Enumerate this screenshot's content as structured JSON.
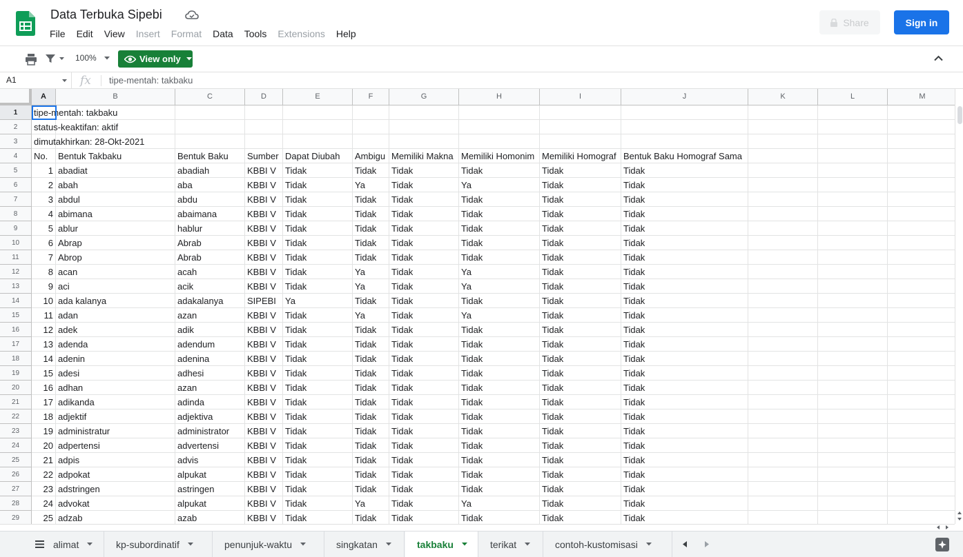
{
  "document": {
    "title": "Data Terbuka Sipebi"
  },
  "menu": [
    {
      "label": "File",
      "enabled": true
    },
    {
      "label": "Edit",
      "enabled": true
    },
    {
      "label": "View",
      "enabled": true
    },
    {
      "label": "Insert",
      "enabled": false
    },
    {
      "label": "Format",
      "enabled": false
    },
    {
      "label": "Data",
      "enabled": true
    },
    {
      "label": "Tools",
      "enabled": true
    },
    {
      "label": "Extensions",
      "enabled": false
    },
    {
      "label": "Help",
      "enabled": true
    }
  ],
  "header": {
    "share_label": "Share",
    "signin_label": "Sign in"
  },
  "toolbar": {
    "zoom": "100%",
    "view_only_label": "View only"
  },
  "formula_bar": {
    "cell_ref": "A1",
    "content": "tipe-mentah: takbaku"
  },
  "columns": [
    "A",
    "B",
    "C",
    "D",
    "E",
    "F",
    "G",
    "H",
    "I",
    "J",
    "K",
    "L",
    "M"
  ],
  "selected_column": "A",
  "rows": [
    {
      "n": "1",
      "cells": [
        "tipe-mentah: takbaku",
        "",
        "",
        "",
        "",
        "",
        "",
        "",
        "",
        ""
      ]
    },
    {
      "n": "2",
      "cells": [
        "status-keaktifan: aktif",
        "",
        "",
        "",
        "",
        "",
        "",
        "",
        "",
        ""
      ]
    },
    {
      "n": "3",
      "cells": [
        "dimutakhirkan: 28-Okt-2021",
        "",
        "",
        "",
        "",
        "",
        "",
        "",
        "",
        ""
      ]
    },
    {
      "n": "4",
      "cells": [
        "No.",
        "Bentuk Takbaku",
        "Bentuk Baku",
        "Sumber",
        "Dapat Diubah",
        "Ambigu",
        "Memiliki Makna",
        "Memiliki Homonim",
        "Memiliki Homograf",
        "Bentuk Baku Homograf Sama"
      ]
    },
    {
      "n": "5",
      "cells": [
        "1",
        "abadiat",
        "abadiah",
        "KBBI V",
        "Tidak",
        "Tidak",
        "Tidak",
        "Tidak",
        "Tidak",
        "Tidak"
      ]
    },
    {
      "n": "6",
      "cells": [
        "2",
        "abah",
        "aba",
        "KBBI V",
        "Tidak",
        "Ya",
        "Tidak",
        "Ya",
        "Tidak",
        "Tidak"
      ]
    },
    {
      "n": "7",
      "cells": [
        "3",
        "abdul",
        "abdu",
        "KBBI V",
        "Tidak",
        "Tidak",
        "Tidak",
        "Tidak",
        "Tidak",
        "Tidak"
      ]
    },
    {
      "n": "8",
      "cells": [
        "4",
        "abimana",
        "abaimana",
        "KBBI V",
        "Tidak",
        "Tidak",
        "Tidak",
        "Tidak",
        "Tidak",
        "Tidak"
      ]
    },
    {
      "n": "9",
      "cells": [
        "5",
        "ablur",
        "hablur",
        "KBBI V",
        "Tidak",
        "Tidak",
        "Tidak",
        "Tidak",
        "Tidak",
        "Tidak"
      ]
    },
    {
      "n": "10",
      "cells": [
        "6",
        "Abrap",
        "Abrab",
        "KBBI V",
        "Tidak",
        "Tidak",
        "Tidak",
        "Tidak",
        "Tidak",
        "Tidak"
      ]
    },
    {
      "n": "11",
      "cells": [
        "7",
        "Abrop",
        "Abrab",
        "KBBI V",
        "Tidak",
        "Tidak",
        "Tidak",
        "Tidak",
        "Tidak",
        "Tidak"
      ]
    },
    {
      "n": "12",
      "cells": [
        "8",
        "acan",
        "acah",
        "KBBI V",
        "Tidak",
        "Ya",
        "Tidak",
        "Ya",
        "Tidak",
        "Tidak"
      ]
    },
    {
      "n": "13",
      "cells": [
        "9",
        "aci",
        "acik",
        "KBBI V",
        "Tidak",
        "Ya",
        "Tidak",
        "Ya",
        "Tidak",
        "Tidak"
      ]
    },
    {
      "n": "14",
      "cells": [
        "10",
        "ada kalanya",
        "adakalanya",
        "SIPEBI",
        "Ya",
        "Tidak",
        "Tidak",
        "Tidak",
        "Tidak",
        "Tidak"
      ]
    },
    {
      "n": "15",
      "cells": [
        "11",
        "adan",
        "azan",
        "KBBI V",
        "Tidak",
        "Ya",
        "Tidak",
        "Ya",
        "Tidak",
        "Tidak"
      ]
    },
    {
      "n": "16",
      "cells": [
        "12",
        "adek",
        "adik",
        "KBBI V",
        "Tidak",
        "Tidak",
        "Tidak",
        "Tidak",
        "Tidak",
        "Tidak"
      ]
    },
    {
      "n": "17",
      "cells": [
        "13",
        "adenda",
        "adendum",
        "KBBI V",
        "Tidak",
        "Tidak",
        "Tidak",
        "Tidak",
        "Tidak",
        "Tidak"
      ]
    },
    {
      "n": "18",
      "cells": [
        "14",
        "adenin",
        "adenina",
        "KBBI V",
        "Tidak",
        "Tidak",
        "Tidak",
        "Tidak",
        "Tidak",
        "Tidak"
      ]
    },
    {
      "n": "19",
      "cells": [
        "15",
        "adesi",
        "adhesi",
        "KBBI V",
        "Tidak",
        "Tidak",
        "Tidak",
        "Tidak",
        "Tidak",
        "Tidak"
      ]
    },
    {
      "n": "20",
      "cells": [
        "16",
        "adhan",
        "azan",
        "KBBI V",
        "Tidak",
        "Tidak",
        "Tidak",
        "Tidak",
        "Tidak",
        "Tidak"
      ]
    },
    {
      "n": "21",
      "cells": [
        "17",
        "adikanda",
        "adinda",
        "KBBI V",
        "Tidak",
        "Tidak",
        "Tidak",
        "Tidak",
        "Tidak",
        "Tidak"
      ]
    },
    {
      "n": "22",
      "cells": [
        "18",
        "adjektif",
        "adjektiva",
        "KBBI V",
        "Tidak",
        "Tidak",
        "Tidak",
        "Tidak",
        "Tidak",
        "Tidak"
      ]
    },
    {
      "n": "23",
      "cells": [
        "19",
        "administratur",
        "administrator",
        "KBBI V",
        "Tidak",
        "Tidak",
        "Tidak",
        "Tidak",
        "Tidak",
        "Tidak"
      ]
    },
    {
      "n": "24",
      "cells": [
        "20",
        "adpertensi",
        "advertensi",
        "KBBI V",
        "Tidak",
        "Tidak",
        "Tidak",
        "Tidak",
        "Tidak",
        "Tidak"
      ]
    },
    {
      "n": "25",
      "cells": [
        "21",
        "adpis",
        "advis",
        "KBBI V",
        "Tidak",
        "Tidak",
        "Tidak",
        "Tidak",
        "Tidak",
        "Tidak"
      ]
    },
    {
      "n": "26",
      "cells": [
        "22",
        "adpokat",
        "alpukat",
        "KBBI V",
        "Tidak",
        "Tidak",
        "Tidak",
        "Tidak",
        "Tidak",
        "Tidak"
      ]
    },
    {
      "n": "27",
      "cells": [
        "23",
        "adstringen",
        "astringen",
        "KBBI V",
        "Tidak",
        "Tidak",
        "Tidak",
        "Tidak",
        "Tidak",
        "Tidak"
      ]
    },
    {
      "n": "28",
      "cells": [
        "24",
        "advokat",
        "alpukat",
        "KBBI V",
        "Tidak",
        "Ya",
        "Tidak",
        "Ya",
        "Tidak",
        "Tidak"
      ]
    },
    {
      "n": "29",
      "cells": [
        "25",
        "adzab",
        "azab",
        "KBBI V",
        "Tidak",
        "Tidak",
        "Tidak",
        "Tidak",
        "Tidak",
        "Tidak"
      ]
    }
  ],
  "sheet_tabs": [
    {
      "label": "alimat",
      "active": false
    },
    {
      "label": "kp-subordinatif",
      "active": false
    },
    {
      "label": "penunjuk-waktu",
      "active": false
    },
    {
      "label": "singkatan",
      "active": false
    },
    {
      "label": "takbaku",
      "active": true
    },
    {
      "label": "terikat",
      "active": false
    },
    {
      "label": "contoh-kustomisasi",
      "active": false
    }
  ],
  "colors": {
    "accent_blue": "#1a73e8",
    "view_only_green": "#188038",
    "sheets_green": "#0f9d58"
  },
  "icons": [
    "sheets-logo-icon",
    "cloud-icon",
    "lock-icon",
    "print-icon",
    "filter-icon",
    "eye-icon",
    "collapse-icon",
    "fx-icon",
    "all-sheets-icon",
    "explore-icon"
  ]
}
